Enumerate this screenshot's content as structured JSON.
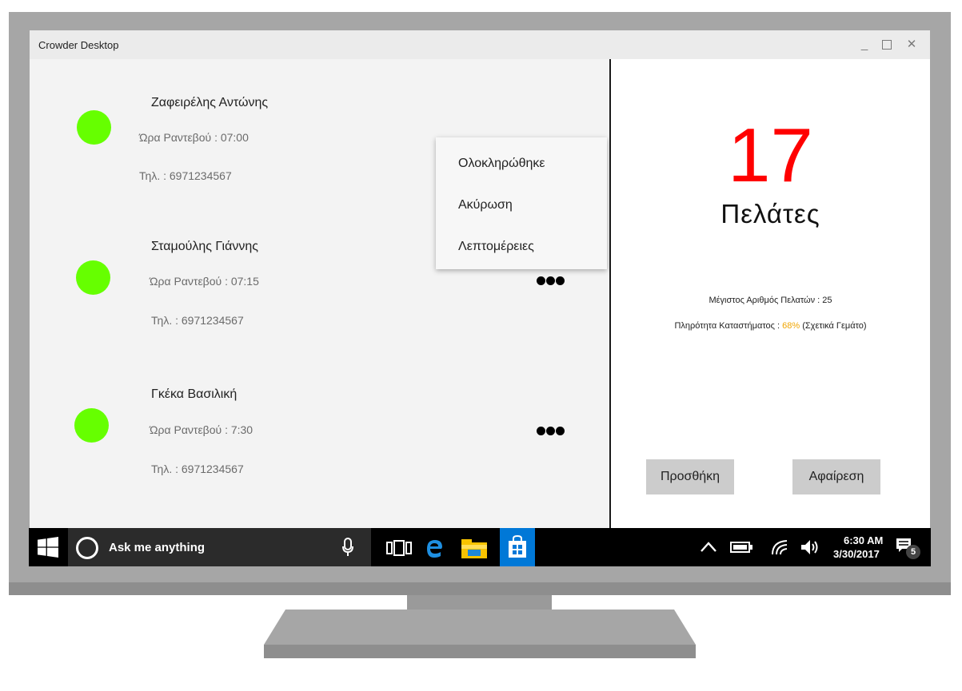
{
  "window": {
    "title": "Crowder Desktop",
    "controls": {
      "minimize": "_",
      "close": "✕"
    }
  },
  "customers": [
    {
      "name": "Ζαφειρέλης Αντώνης",
      "appointment": "Ώρα Ραντεβού : 07:00",
      "phone": "Τηλ. : 6971234567",
      "status_color": "#66ff00"
    },
    {
      "name": "Σταμούλης Γιάννης",
      "appointment": "Ώρα Ραντεβού : 07:15",
      "phone": "Τηλ. : 6971234567",
      "status_color": "#66ff00"
    },
    {
      "name": "Γκέκα Βασιλική",
      "appointment": "Ώρα Ραντεβού : 7:30",
      "phone": "Τηλ. : 6971234567",
      "status_color": "#66ff00"
    }
  ],
  "context_menu": {
    "items": [
      "Ολοκληρώθηκε",
      "Ακύρωση",
      "Λεπτομέρειες"
    ]
  },
  "stats": {
    "count": "17",
    "count_label": "Πελάτες",
    "max_customers": "Μέγιστος Αριθμός Πελατών : 25",
    "fullness_prefix": "Πληρότητα Καταστήματος : ",
    "fullness_value": "68%",
    "fullness_suffix": " (Σχετικά Γεμάτο)",
    "accent_color": "#ff0000",
    "fullness_color": "#f0a500"
  },
  "buttons": {
    "add": "Προσθήκη",
    "remove": "Αφαίρεση"
  },
  "taskbar": {
    "search_placeholder": "Ask me anything",
    "time": "6:30 AM",
    "date": "3/30/2017",
    "notification_count": "5"
  }
}
